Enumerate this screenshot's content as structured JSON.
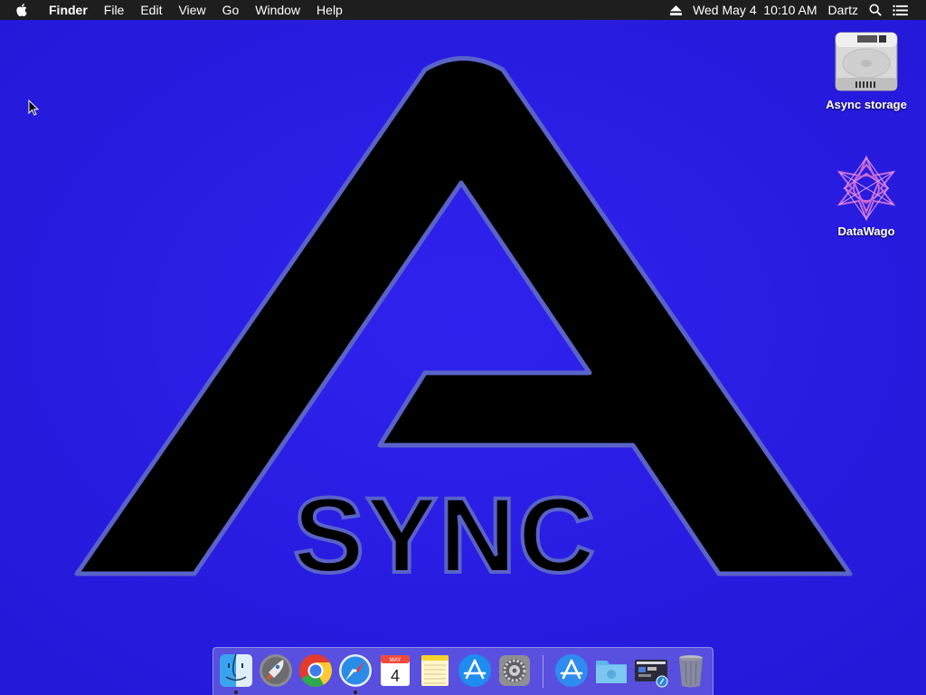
{
  "menubar": {
    "app_name": "Finder",
    "menus": [
      "File",
      "Edit",
      "View",
      "Go",
      "Window",
      "Help"
    ],
    "clock": "Wed May 4  10:10 AM",
    "user": "Dartz"
  },
  "desktop": {
    "icons": [
      {
        "label": "Async storage",
        "icon": "hard-drive-icon"
      },
      {
        "label": "DataWago",
        "icon": "datawago-star-icon"
      }
    ]
  },
  "dock": {
    "items": [
      {
        "name": "Finder",
        "icon": "finder-icon",
        "running": true
      },
      {
        "name": "Launchpad",
        "icon": "launchpad-icon",
        "running": false
      },
      {
        "name": "Google Chrome",
        "icon": "chrome-icon",
        "running": false
      },
      {
        "name": "Safari",
        "icon": "safari-icon",
        "running": true
      },
      {
        "name": "Calendar",
        "icon": "calendar-icon",
        "running": false
      },
      {
        "name": "Notes",
        "icon": "notes-icon",
        "running": false
      },
      {
        "name": "App Store",
        "icon": "app-store-icon",
        "running": false
      },
      {
        "name": "System Preferences",
        "icon": "system-preferences-icon",
        "running": false
      },
      {
        "name": "Applications",
        "icon": "applications-folder-icon",
        "running": false
      },
      {
        "name": "Folder",
        "icon": "folder-icon",
        "running": false
      },
      {
        "name": "Screenshot",
        "icon": "screenshot-stack-icon",
        "running": false
      },
      {
        "name": "Trash",
        "icon": "trash-icon",
        "running": false
      }
    ],
    "calendar": {
      "month": "MAY",
      "day": "4"
    }
  },
  "wallpaper": {
    "logo_text": "SYNC",
    "colors": {
      "background": "#2a1be6",
      "logo": "#000000",
      "outline": "#5a63c8"
    }
  }
}
